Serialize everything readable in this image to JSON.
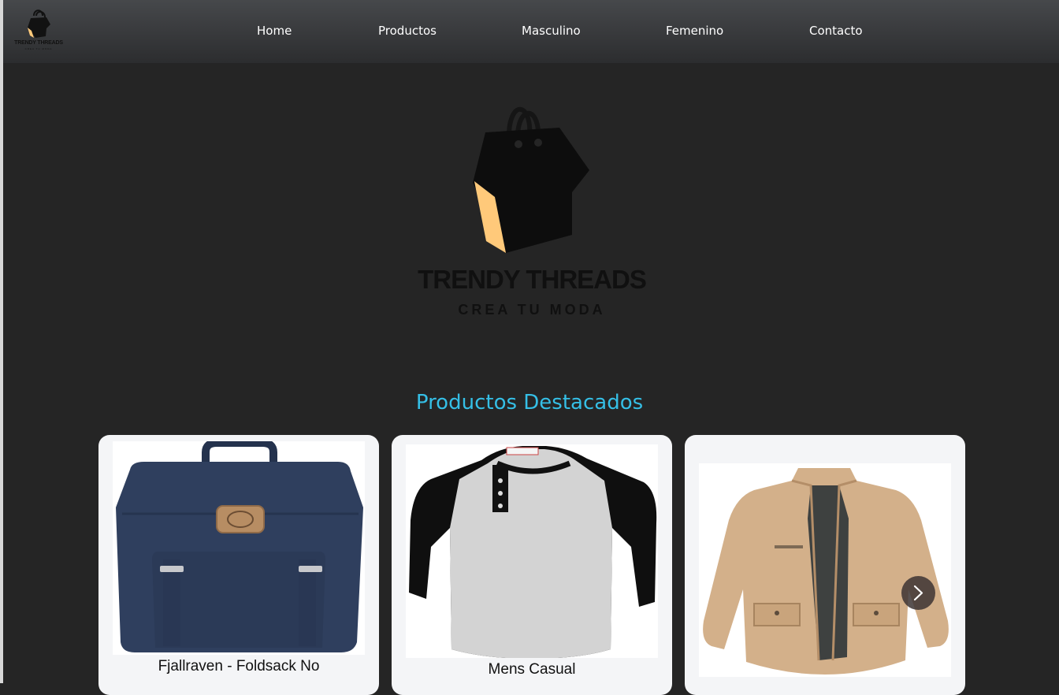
{
  "nav": {
    "logo_text": "TRENDY THREADS",
    "logo_subtext": "CREA TU MODA",
    "links": [
      "Home",
      "Productos",
      "Masculino",
      "Femenino",
      "Contacto"
    ]
  },
  "hero": {
    "title": "TRENDY THREADS",
    "subtitle": "CREA TU MODA"
  },
  "featured": {
    "title": "Productos Destacados",
    "products": [
      {
        "name": "Fjallraven - Foldsack No"
      },
      {
        "name": "Mens Casual"
      },
      {
        "name": ""
      }
    ],
    "next_icon": "chevron-right-icon"
  },
  "colors": {
    "accent": "#35bfe6",
    "logo_yellow": "#ffc97a",
    "background": "#252525"
  }
}
